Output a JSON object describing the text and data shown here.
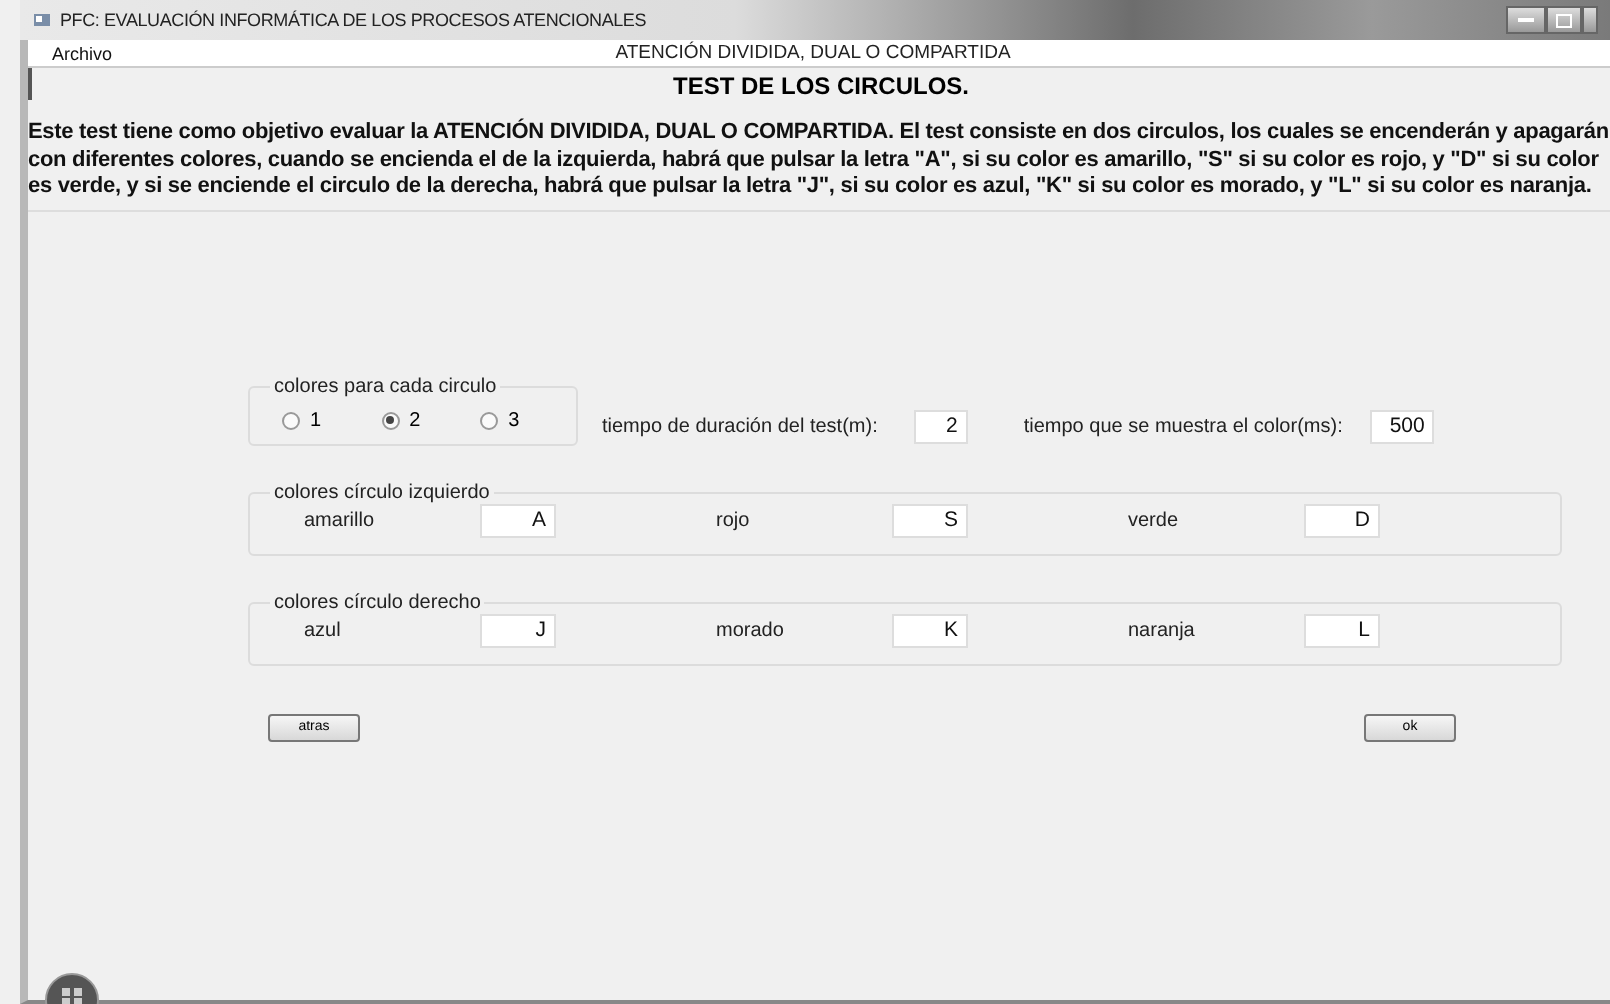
{
  "window": {
    "title": "PFC: EVALUACIÓN INFORMÁTICA DE LOS PROCESOS ATENCIONALES"
  },
  "menu": [
    "Archivo"
  ],
  "subtitle": "ATENCIÓN DIVIDIDA, DUAL O COMPARTIDA",
  "heading": "TEST DE LOS CIRCULOS.",
  "description": "Este test  tiene como objetivo evaluar la ATENCIÓN DIVIDIDA, DUAL O COMPARTIDA. El test consiste en dos circulos, los cuales se encenderán y apagarán con diferentes colores, cuando se encienda el de la izquierda, habrá que pulsar la letra \"A\", si su color es amarillo, \"S\" si su color es rojo, y \"D\" si su color es verde, y si se enciende el circulo de la derecha, habrá que pulsar la letra \"J\", si su color es azul, \"K\" si su color es morado, y \"L\" si su color es naranja.",
  "colors_group": {
    "title": "colores para cada circulo",
    "options": [
      {
        "label": "1",
        "selected": false
      },
      {
        "label": "2",
        "selected": true
      },
      {
        "label": "3",
        "selected": false
      }
    ]
  },
  "duration": {
    "label": "tiempo de duración del test(m):",
    "value": "2"
  },
  "display_time": {
    "label": "tiempo que se muestra el color(ms):",
    "value": "500"
  },
  "key_groups": [
    {
      "title": "colores círculo izquierdo",
      "keys": [
        {
          "label": "amarillo",
          "value": "A"
        },
        {
          "label": "rojo",
          "value": "S"
        },
        {
          "label": "verde",
          "value": "D"
        }
      ]
    },
    {
      "title": "colores círculo derecho",
      "keys": [
        {
          "label": "azul",
          "value": "J"
        },
        {
          "label": "morado",
          "value": "K"
        },
        {
          "label": "naranja",
          "value": "L"
        }
      ]
    }
  ],
  "buttons": [
    "atras",
    "ok"
  ]
}
